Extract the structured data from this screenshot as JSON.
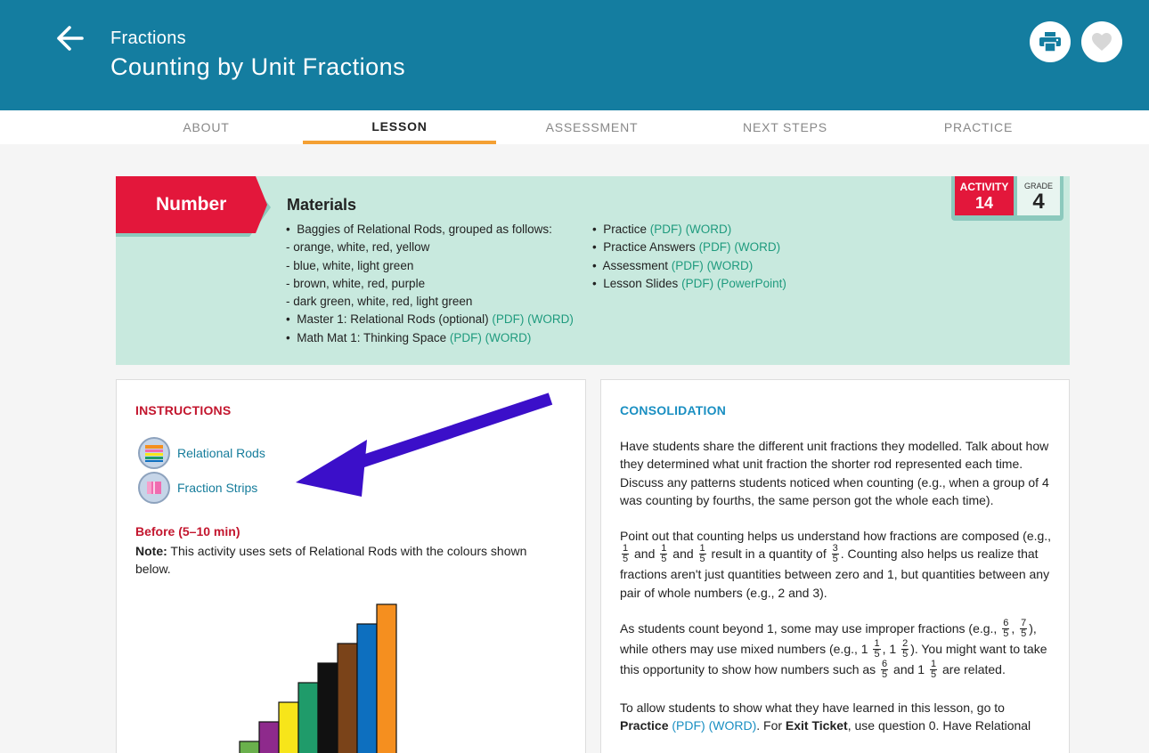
{
  "header": {
    "subtitle": "Fractions",
    "title": "Counting by Unit Fractions",
    "back_icon": "arrow-left-icon",
    "print_icon": "printer-icon",
    "favorite_icon": "heart-icon",
    "accent_color": "#147da0"
  },
  "tabs": [
    {
      "label": "ABOUT"
    },
    {
      "label": "LESSON",
      "active": true
    },
    {
      "label": "ASSESSMENT"
    },
    {
      "label": "NEXT STEPS"
    },
    {
      "label": "PRACTICE"
    }
  ],
  "materials": {
    "strand": "Number",
    "heading": "Materials",
    "left_items": [
      {
        "bullet": "•",
        "text": "Baggies of Relational Rods, grouped as follows:"
      },
      {
        "bullet": "",
        "text": "- orange, white, red, yellow"
      },
      {
        "bullet": "",
        "text": "- blue, white, light green"
      },
      {
        "bullet": "",
        "text": "- brown, white, red, purple"
      },
      {
        "bullet": "",
        "text": "- dark green, white, red, light green"
      },
      {
        "bullet": "•",
        "text": "Master 1: Relational Rods (optional)",
        "link1": "(PDF)",
        "link2": "(WORD)"
      },
      {
        "bullet": "•",
        "text": "Math Mat 1: Thinking Space",
        "link1": "(PDF)",
        "link2": "(WORD)"
      }
    ],
    "right_items": [
      {
        "bullet": "•",
        "text": "Practice",
        "link1": "(PDF)",
        "link2": "(WORD)"
      },
      {
        "bullet": "•",
        "text": "Practice Answers",
        "link1": "(PDF)",
        "link2": "(WORD)"
      },
      {
        "bullet": "•",
        "text": "Assessment",
        "link1": "(PDF)",
        "link2": "(WORD)"
      },
      {
        "bullet": "•",
        "text": "Lesson Slides",
        "link1": "(PDF)",
        "link2": "(PowerPoint)"
      }
    ],
    "activity_label": "ACTIVITY",
    "activity_number": "14",
    "grade_label": "GRADE",
    "grade_number": "4"
  },
  "instructions": {
    "heading": "INSTRUCTIONS",
    "tools": [
      {
        "label": "Relational Rods",
        "icon": "relational-rods-icon"
      },
      {
        "label": "Fraction Strips",
        "icon": "fraction-strips-icon"
      }
    ],
    "before_heading": "Before (5–10 min)",
    "note_label": "Note:",
    "note_text": " This activity uses sets of Relational Rods with the colours shown below.",
    "rod_colors": [
      "#6ab04c",
      "#8e2a8c",
      "#f7e51a",
      "#1f9b6a",
      "#111111",
      "#7a4319",
      "#0d6fbf",
      "#f58f1f"
    ]
  },
  "consolidation": {
    "heading": "CONSOLIDATION",
    "p1": "Have students share the different unit fractions they modelled. Talk about how they determined what unit fraction the shorter rod represented each time. Discuss any patterns students noticed when counting (e.g., when a group of 4 was counting by fourths, the same person got the whole each time).",
    "p2": {
      "t1": "Point out that counting helps us understand how fractions are composed (e.g., ",
      "t2": " and ",
      "t3": " and ",
      "t4": " result in a quantity of ",
      "t5": ". Counting also helps us realize that fractions aren't just quantities between zero and 1, but quantities between any pair of whole numbers (e.g., 2 and 3)."
    },
    "p3": {
      "t1": "As students count beyond 1, some may use improper fractions (e.g., ",
      "t2": ",",
      "t3": "), while others may use mixed numbers (e.g., 1",
      "t4": ", 1",
      "t5": "). You might want to take this opportunity to show how numbers such as",
      "t6": " and 1",
      "t7": " are related."
    },
    "p4": {
      "t1": "To allow students to show what they have learned in this lesson, go to ",
      "practice": "Practice",
      "link1": "(PDF)",
      "link2": "(WORD)",
      "t2": ". For ",
      "exit": "Exit Ticket",
      "t3": ", use question 0. Have Relational"
    },
    "fractions": {
      "one_fifth": {
        "n": "1",
        "d": "5"
      },
      "three_fifths": {
        "n": "3",
        "d": "5"
      },
      "six_fifths": {
        "n": "6",
        "d": "5"
      },
      "seven_fifths": {
        "n": "7",
        "d": "5"
      },
      "two_fifths": {
        "n": "2",
        "d": "5"
      }
    }
  }
}
